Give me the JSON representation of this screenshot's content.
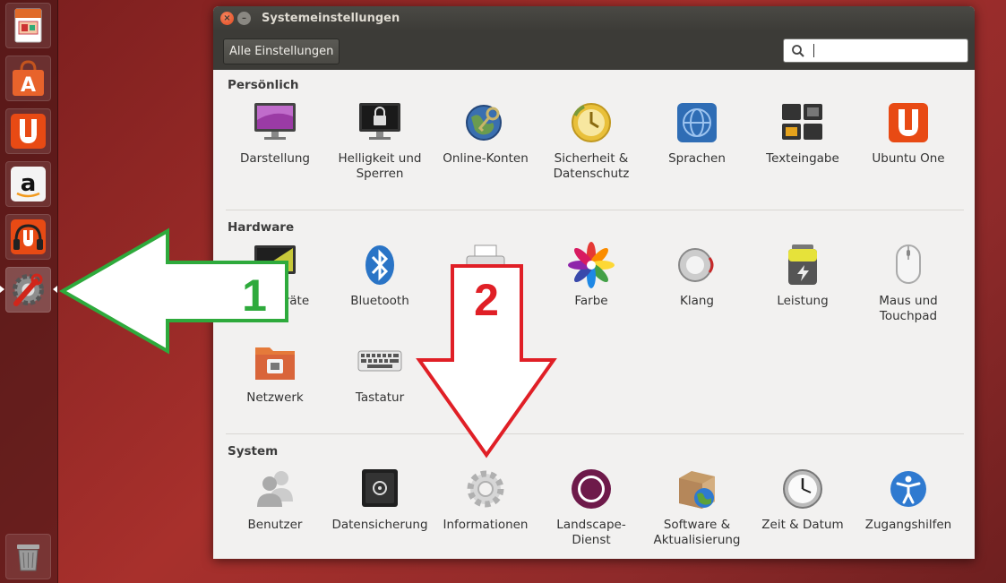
{
  "window": {
    "title": "Systemeinstellungen",
    "all_settings_label": "Alle Einstellungen",
    "search_placeholder": ""
  },
  "launcher": {
    "items": [
      {
        "name": "libreoffice-impress-icon"
      },
      {
        "name": "ubuntu-software-center-icon"
      },
      {
        "name": "ubuntu-one-icon"
      },
      {
        "name": "amazon-icon"
      },
      {
        "name": "ubuntu-one-music-icon"
      },
      {
        "name": "system-settings-icon"
      },
      {
        "name": "trash-icon"
      }
    ]
  },
  "sections": {
    "personal": {
      "title": "Persönlich",
      "items": [
        {
          "label": "Darstellung",
          "icon": "display-icon"
        },
        {
          "label": "Helligkeit und\nSperren",
          "icon": "lock-screen-icon"
        },
        {
          "label": "Online-Konten",
          "icon": "online-accounts-icon"
        },
        {
          "label": "Sicherheit &\nDatenschutz",
          "icon": "privacy-icon"
        },
        {
          "label": "Sprachen",
          "icon": "language-icon"
        },
        {
          "label": "Texteingabe",
          "icon": "keyboard-input-icon"
        },
        {
          "label": "Ubuntu One",
          "icon": "ubuntu-one-icon"
        }
      ]
    },
    "hardware": {
      "title": "Hardware",
      "items": [
        {
          "label": "geräte",
          "icon": "displays-icon"
        },
        {
          "label": "Bluetooth",
          "icon": "bluetooth-icon"
        },
        {
          "label": "",
          "icon": "printer-icon"
        },
        {
          "label": "Farbe",
          "icon": "color-icon"
        },
        {
          "label": "Klang",
          "icon": "sound-icon"
        },
        {
          "label": "Leistung",
          "icon": "power-icon"
        },
        {
          "label": "Maus und\nTouchpad",
          "icon": "mouse-icon"
        },
        {
          "label": "Netzwerk",
          "icon": "network-icon"
        },
        {
          "label": "Tastatur",
          "icon": "keyboard-icon"
        }
      ]
    },
    "system": {
      "title": "System",
      "items": [
        {
          "label": "Benutzer",
          "icon": "users-icon"
        },
        {
          "label": "Datensicherung",
          "icon": "backup-icon"
        },
        {
          "label": "Informationen",
          "icon": "details-gear-icon"
        },
        {
          "label": "Landscape-\nDienst",
          "icon": "landscape-icon"
        },
        {
          "label": "Software &\nAktualisierung",
          "icon": "software-update-icon"
        },
        {
          "label": "Zeit & Datum",
          "icon": "clock-icon"
        },
        {
          "label": "Zugangshilfen",
          "icon": "accessibility-icon"
        }
      ]
    }
  },
  "annotations": {
    "arrow1_label": "1",
    "arrow2_label": "2",
    "arrow1_color": "#2eaa3c",
    "arrow2_color": "#e01f26"
  },
  "colors": {
    "accent": "#dd4814",
    "titlebar": "#3c3b37",
    "window_bg": "#f2f1f0"
  }
}
